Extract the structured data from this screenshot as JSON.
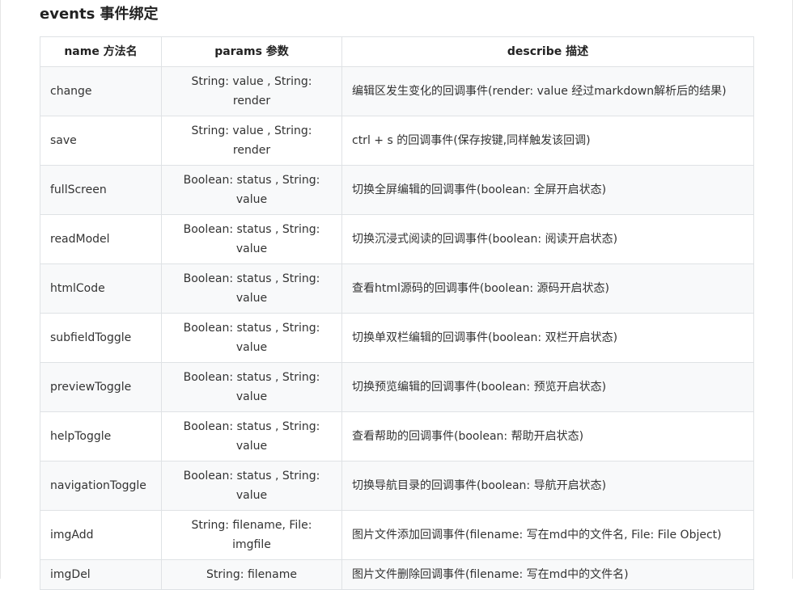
{
  "section": {
    "title": "events 事件绑定"
  },
  "table": {
    "headers": [
      "name 方法名",
      "params 参数",
      "describe 描述"
    ],
    "rows": [
      {
        "name": "change",
        "params": "String: value , String: render",
        "describe": "编辑区发生变化的回调事件(render: value 经过markdown解析后的结果)"
      },
      {
        "name": "save",
        "params": "String: value , String: render",
        "describe": "ctrl + s 的回调事件(保存按键,同样触发该回调)"
      },
      {
        "name": "fullScreen",
        "params": "Boolean: status , String: value",
        "describe": "切换全屏编辑的回调事件(boolean: 全屏开启状态)"
      },
      {
        "name": "readModel",
        "params": "Boolean: status , String: value",
        "describe": "切换沉浸式阅读的回调事件(boolean: 阅读开启状态)"
      },
      {
        "name": "htmlCode",
        "params": "Boolean: status , String: value",
        "describe": "查看html源码的回调事件(boolean: 源码开启状态)"
      },
      {
        "name": "subfieldToggle",
        "params": "Boolean: status , String: value",
        "describe": "切换单双栏编辑的回调事件(boolean: 双栏开启状态)"
      },
      {
        "name": "previewToggle",
        "params": "Boolean: status , String: value",
        "describe": "切换预览编辑的回调事件(boolean: 预览开启状态)"
      },
      {
        "name": "helpToggle",
        "params": "Boolean: status , String: value",
        "describe": "查看帮助的回调事件(boolean: 帮助开启状态)"
      },
      {
        "name": "navigationToggle",
        "params": "Boolean: status , String: value",
        "describe": "切换导航目录的回调事件(boolean: 导航开启状态)"
      },
      {
        "name": "imgAdd",
        "params": "String: filename, File: imgfile",
        "describe": "图片文件添加回调事件(filename: 写在md中的文件名, File: File Object)"
      },
      {
        "name": "imgDel",
        "params": "String: filename",
        "describe": "图片文件删除回调事件(filename: 写在md中的文件名)"
      }
    ]
  }
}
